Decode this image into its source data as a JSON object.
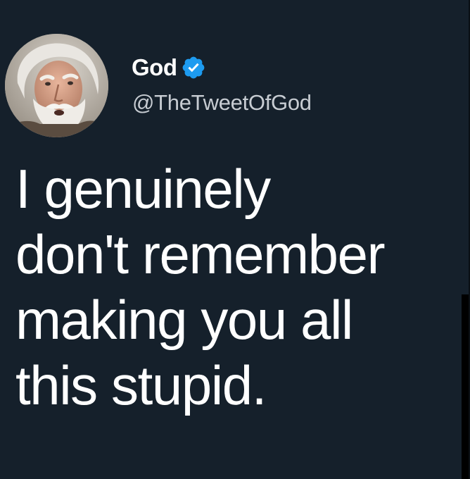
{
  "tweet": {
    "author": {
      "display_name": "God",
      "handle": "@TheTweetOfGod",
      "verified": true,
      "verified_icon": "verified-badge-icon",
      "avatar": "bearded-old-man-portrait"
    },
    "text": "I genuinely\ndon't remember\nmaking you all\nthis stupid."
  },
  "colors": {
    "background": "#15202b",
    "text_primary": "#ffffff",
    "text_secondary": "#c7ccd2",
    "verified_blue": "#1d9bf0"
  }
}
